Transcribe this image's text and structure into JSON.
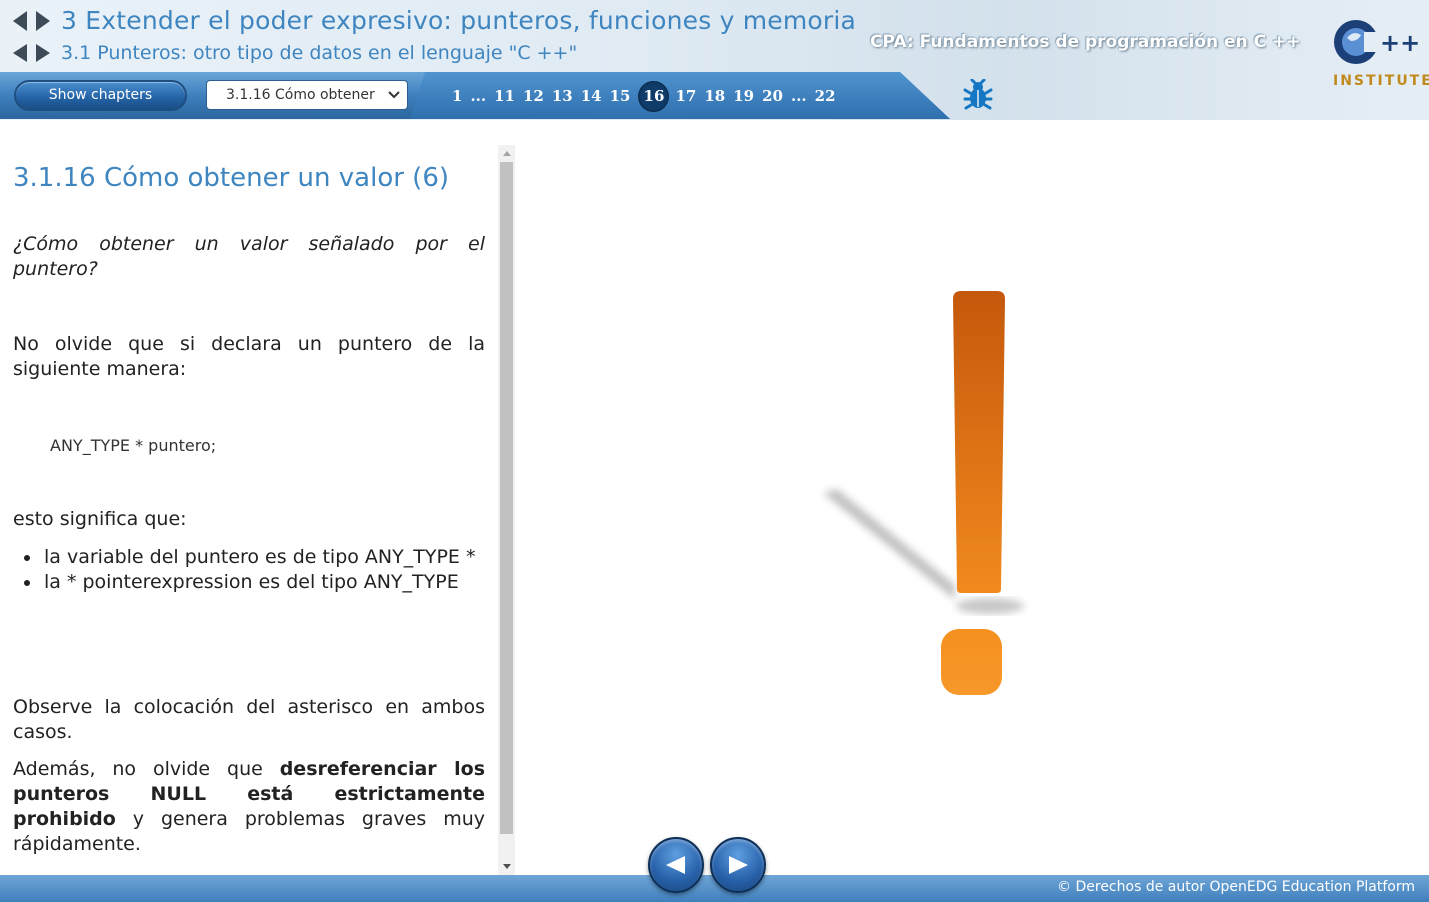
{
  "header": {
    "chapter_title": "3 Extender el poder expresivo: punteros, funciones y memoria",
    "section_title": "3.1 Punteros: otro tipo de datos en el lenguaje \"C ++\"",
    "course_title": "CPA: Fundamentos de programación en C ++",
    "logo_text": "INSTITUTE",
    "logo_plus": "++"
  },
  "navbar": {
    "show_chapters_label": "Show chapters",
    "page_select_value": "3.1.16 Cómo obtener",
    "pages": [
      {
        "label": "1",
        "current": false
      },
      {
        "label": "...",
        "current": false,
        "ellipsis": true
      },
      {
        "label": "11",
        "current": false
      },
      {
        "label": "12",
        "current": false
      },
      {
        "label": "13",
        "current": false
      },
      {
        "label": "14",
        "current": false
      },
      {
        "label": "15",
        "current": false
      },
      {
        "label": "16",
        "current": true
      },
      {
        "label": "17",
        "current": false
      },
      {
        "label": "18",
        "current": false
      },
      {
        "label": "19",
        "current": false
      },
      {
        "label": "20",
        "current": false
      },
      {
        "label": "...",
        "current": false,
        "ellipsis": true
      },
      {
        "label": "22",
        "current": false
      }
    ]
  },
  "content": {
    "heading": "3.1.16 Cómo obtener un valor (6)",
    "question": "¿Cómo obtener un valor señalado por el puntero?",
    "intro": "No olvide que si declara un puntero de la siguiente manera:",
    "code": "ANY_TYPE * puntero;",
    "means": "esto significa que:",
    "bullets": [
      "la variable del puntero es de tipo ANY_TYPE *",
      "la * pointerexpression es del tipo ANY_TYPE"
    ],
    "observe": "Observe la colocación del asterisco en ambos casos.",
    "warning_prefix": "Además, no olvide que ",
    "warning_bold": "desreferenciar los punteros NULL está estrictamente prohibido",
    "warning_suffix": " y genera problemas graves muy rápidamente."
  },
  "footer": {
    "copyright": "© Derechos de autor OpenEDG Education Platform"
  },
  "colors": {
    "accent": "#3f85c0",
    "navbar": "#3e7fbd",
    "exclamation": "#e8731a",
    "current_page": "#0f3c6a"
  },
  "icons": {
    "prev_chapter": "triangle-left-icon",
    "next_chapter": "triangle-right-icon",
    "bug": "bug-icon",
    "dropdown": "chevron-down-icon",
    "prev_page": "play-left-icon",
    "next_page": "play-right-icon",
    "illustration": "exclamation-mark-icon"
  }
}
